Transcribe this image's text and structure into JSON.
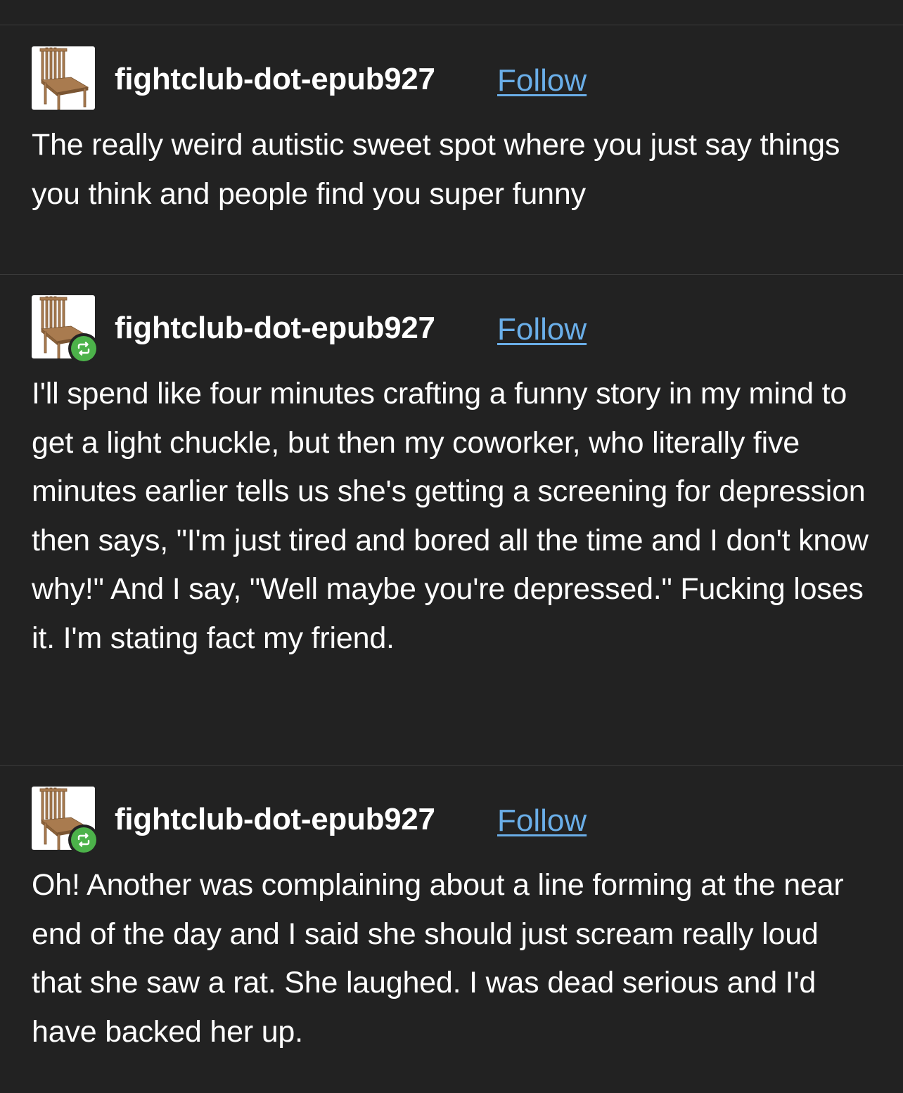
{
  "posts": [
    {
      "username": "fightclub-dot-epub927",
      "follow_label": "Follow",
      "avatar_icon": "chair-avatar-icon",
      "reblog_badge": false,
      "text": "The really weird autistic sweet spot where you just say things you think and people find you super funny"
    },
    {
      "username": "fightclub-dot-epub927",
      "follow_label": "Follow",
      "avatar_icon": "chair-avatar-icon",
      "reblog_badge": true,
      "text": "I'll spend like four minutes crafting a funny story in my mind to get a light chuckle, but then my coworker, who literally five minutes earlier tells us she's getting a screening for depression then says, \"I'm just tired and bored all the time and I don't know why!\" And I say, \"Well maybe you're depressed.\" Fucking loses it. I'm stating fact my friend."
    },
    {
      "username": "fightclub-dot-epub927",
      "follow_label": "Follow",
      "avatar_icon": "chair-avatar-icon",
      "reblog_badge": true,
      "text": "Oh! Another was complaining about a line forming at the near end of the day and I said she should just scream really loud that she saw a rat. She laughed. I was dead serious and I'd have backed her up."
    }
  ],
  "colors": {
    "background": "#222222",
    "text": "#ffffff",
    "link": "#6aaee8",
    "reblog_badge": "#4cb24a",
    "divider": "#3a3a3a"
  }
}
